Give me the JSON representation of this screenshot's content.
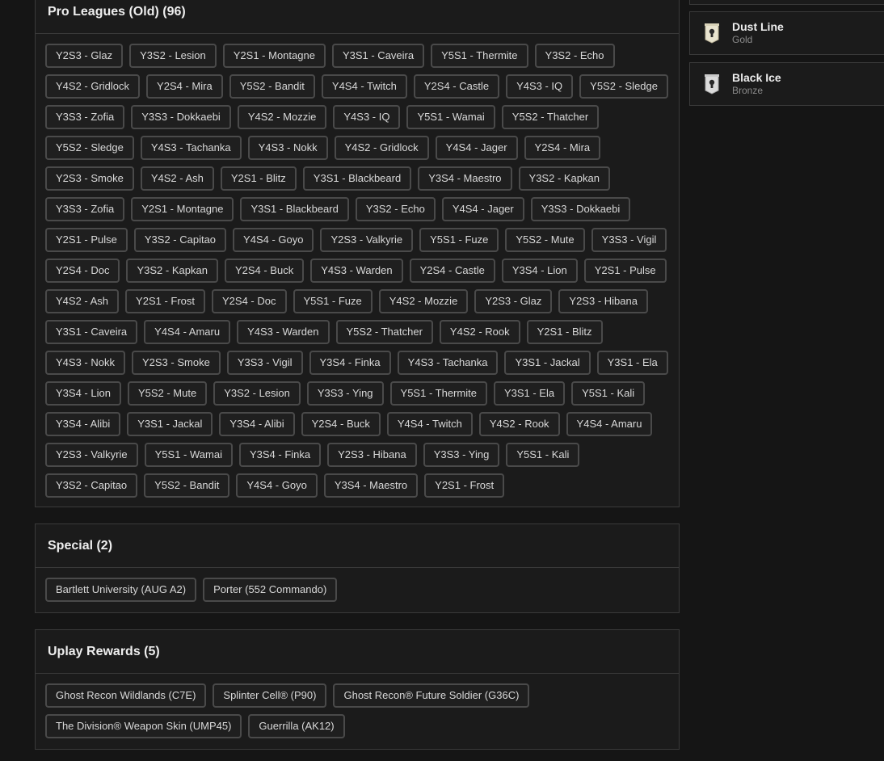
{
  "pro_leagues": {
    "title": "Pro Leagues (Old) (96)",
    "items": [
      "Y2S3 - Glaz",
      "Y3S2 - Lesion",
      "Y2S1 - Montagne",
      "Y3S1 - Caveira",
      "Y5S1 - Thermite",
      "Y3S2 - Echo",
      "Y4S2 - Gridlock",
      "Y2S4 - Mira",
      "Y5S2 - Bandit",
      "Y4S4 - Twitch",
      "Y2S4 - Castle",
      "Y4S3 - IQ",
      "Y5S2 - Sledge",
      "Y3S3 - Zofia",
      "Y3S3 - Dokkaebi",
      "Y4S2 - Mozzie",
      "Y4S3 - IQ",
      "Y5S1 - Wamai",
      "Y5S2 - Thatcher",
      "Y5S2 - Sledge",
      "Y4S3 - Tachanka",
      "Y4S3 - Nokk",
      "Y4S2 - Gridlock",
      "Y4S4 - Jager",
      "Y2S4 - Mira",
      "Y2S3 - Smoke",
      "Y4S2 - Ash",
      "Y2S1 - Blitz",
      "Y3S1 - Blackbeard",
      "Y3S4 - Maestro",
      "Y3S2 - Kapkan",
      "Y3S3 - Zofia",
      "Y2S1 - Montagne",
      "Y3S1 - Blackbeard",
      "Y3S2 - Echo",
      "Y4S4 - Jager",
      "Y3S3 - Dokkaebi",
      "Y2S1 - Pulse",
      "Y3S2 - Capitao",
      "Y4S4 - Goyo",
      "Y2S3 - Valkyrie",
      "Y5S1 - Fuze",
      "Y5S2 - Mute",
      "Y3S3 - Vigil",
      "Y2S4 - Doc",
      "Y3S2 - Kapkan",
      "Y2S4 - Buck",
      "Y4S3 - Warden",
      "Y2S4 - Castle",
      "Y3S4 - Lion",
      "Y2S1 - Pulse",
      "Y4S2 - Ash",
      "Y2S1 - Frost",
      "Y2S4 - Doc",
      "Y5S1 - Fuze",
      "Y4S2 - Mozzie",
      "Y2S3 - Glaz",
      "Y2S3 - Hibana",
      "Y3S1 - Caveira",
      "Y4S4 - Amaru",
      "Y4S3 - Warden",
      "Y5S2 - Thatcher",
      "Y4S2 - Rook",
      "Y2S1 - Blitz",
      "Y4S3 - Nokk",
      "Y2S3 - Smoke",
      "Y3S3 - Vigil",
      "Y3S4 - Finka",
      "Y4S3 - Tachanka",
      "Y3S1 - Jackal",
      "Y3S1 - Ela",
      "Y3S4 - Lion",
      "Y5S2 - Mute",
      "Y3S2 - Lesion",
      "Y3S3 - Ying",
      "Y5S1 - Thermite",
      "Y3S1 - Ela",
      "Y5S1 - Kali",
      "Y3S4 - Alibi",
      "Y3S1 - Jackal",
      "Y3S4 - Alibi",
      "Y2S4 - Buck",
      "Y4S4 - Twitch",
      "Y4S2 - Rook",
      "Y4S4 - Amaru",
      "Y2S3 - Valkyrie",
      "Y5S1 - Wamai",
      "Y3S4 - Finka",
      "Y2S3 - Hibana",
      "Y3S3 - Ying",
      "Y5S1 - Kali",
      "Y3S2 - Capitao",
      "Y5S2 - Bandit",
      "Y4S4 - Goyo",
      "Y3S4 - Maestro",
      "Y2S1 - Frost"
    ]
  },
  "special": {
    "title": "Special (2)",
    "items": [
      "Bartlett University (AUG A2)",
      "Porter (552 Commando)"
    ]
  },
  "uplay": {
    "title": "Uplay Rewards (5)",
    "items": [
      "Ghost Recon Wildlands (C7E)",
      "Splinter Cell® (P90)",
      "Ghost Recon® Future Soldier (G36C)",
      "The Division® Weapon Skin (UMP45)",
      "Guerrilla (AK12)"
    ]
  },
  "sidebar": {
    "cards": [
      {
        "name": "Dust Line",
        "rank": "Gold",
        "icon": "banner-badge-icon"
      },
      {
        "name": "Black Ice",
        "rank": "Bronze",
        "icon": "banner-badge-icon"
      }
    ]
  }
}
